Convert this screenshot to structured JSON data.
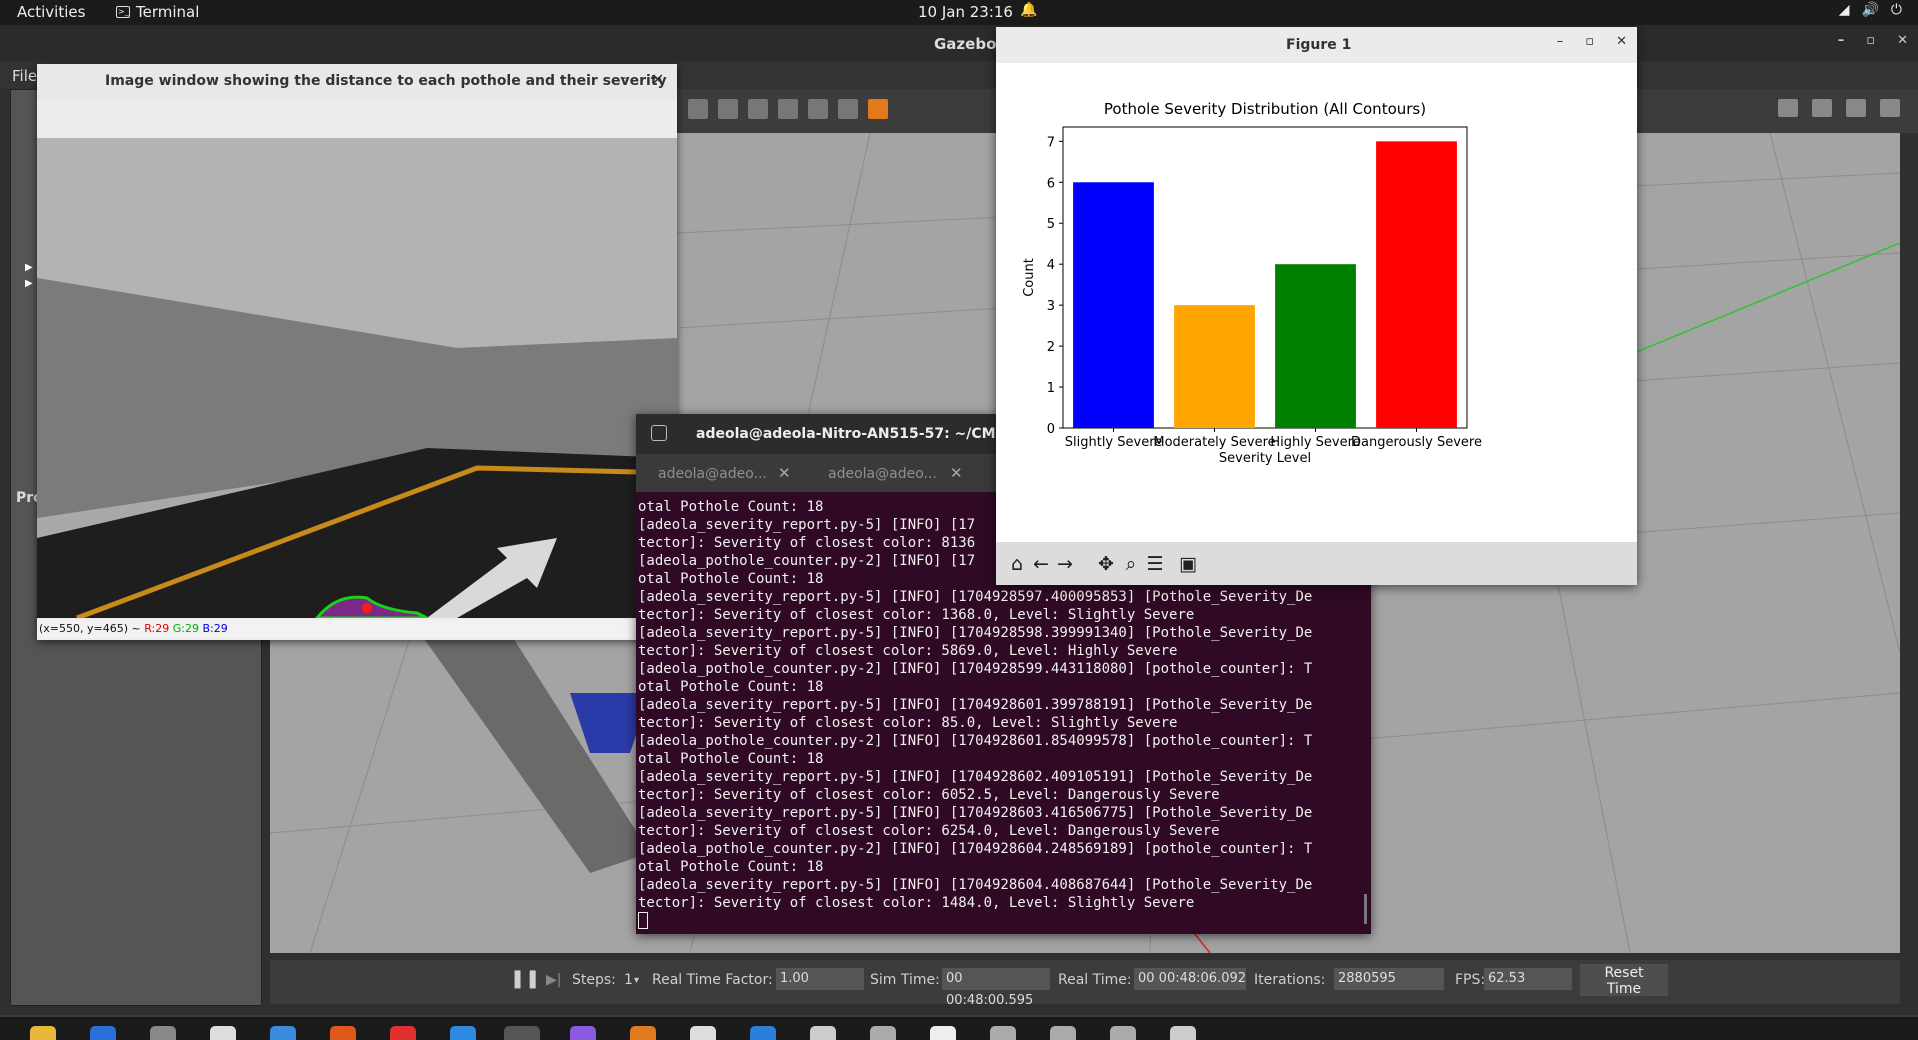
{
  "topbar": {
    "activities": "Activities",
    "app_name": "Terminal",
    "clock": "10 Jan  23:16"
  },
  "gazebo": {
    "title": "Gazebo",
    "menu_file": "File",
    "left_panel_label": "Pro",
    "bottom": {
      "steps_label": "Steps:",
      "steps_value": "1",
      "rtf_label": "Real Time Factor:",
      "rtf_value": "1.00",
      "sim_time_label": "Sim Time:",
      "sim_time_value": "00 00:48:00.595",
      "real_time_label": "Real Time:",
      "real_time_value": "00 00:48:06.092",
      "iterations_label": "Iterations:",
      "iterations_value": "2880595",
      "fps_label": "FPS:",
      "fps_value": "62.53",
      "reset_label": "Reset Time"
    }
  },
  "image_window": {
    "title": "Image window showing the distance to each pothole and their severity",
    "status_pos": "(x=550, y=465) ~",
    "status_r": "R:29",
    "status_g": "G:29",
    "status_b": "B:29"
  },
  "terminal": {
    "title": "adeola@adeola-Nitro-AN515-57: ~/CMP97",
    "tab1": "adeola@adeo...",
    "tab2": "adeola@adeo...",
    "lines": [
      "otal Pothole Count: 18",
      "[adeola_severity_report.py-5] [INFO] [17",
      "tector]: Severity of closest color: 8136",
      "[adeola_pothole_counter.py-2] [INFO] [17",
      "otal Pothole Count: 18",
      "[adeola_severity_report.py-5] [INFO] [1704928597.400095853] [Pothole_Severity_De",
      "tector]: Severity of closest color: 1368.0, Level: Slightly Severe",
      "[adeola_severity_report.py-5] [INFO] [1704928598.399991340] [Pothole_Severity_De",
      "tector]: Severity of closest color: 5869.0, Level: Highly Severe",
      "[adeola_pothole_counter.py-2] [INFO] [1704928599.443118080] [pothole_counter]: T",
      "otal Pothole Count: 18",
      "[adeola_severity_report.py-5] [INFO] [1704928601.399788191] [Pothole_Severity_De",
      "tector]: Severity of closest color: 85.0, Level: Slightly Severe",
      "[adeola_pothole_counter.py-2] [INFO] [1704928601.854099578] [pothole_counter]: T",
      "otal Pothole Count: 18",
      "[adeola_severity_report.py-5] [INFO] [1704928602.409105191] [Pothole_Severity_De",
      "tector]: Severity of closest color: 6052.5, Level: Dangerously Severe",
      "[adeola_severity_report.py-5] [INFO] [1704928603.416506775] [Pothole_Severity_De",
      "tector]: Severity of closest color: 6254.0, Level: Dangerously Severe",
      "[adeola_pothole_counter.py-2] [INFO] [1704928604.248569189] [pothole_counter]: T",
      "otal Pothole Count: 18",
      "[adeola_severity_report.py-5] [INFO] [1704928604.408687644] [Pothole_Severity_De",
      "tector]: Severity of closest color: 1484.0, Level: Slightly Severe"
    ]
  },
  "figure": {
    "window_title": "Figure 1"
  },
  "chart_data": {
    "type": "bar",
    "title": "Pothole Severity Distribution (All Contours)",
    "xlabel": "Severity Level",
    "ylabel": "Count",
    "categories": [
      "Slightly Severe",
      "Moderately Severe",
      "Highly Severe",
      "Dangerously Severe"
    ],
    "values": [
      6,
      3,
      4,
      7
    ],
    "colors": [
      "#0000ff",
      "#ffa500",
      "#008000",
      "#ff0000"
    ],
    "ylim": [
      0,
      7.35
    ],
    "yticks": [
      0,
      1,
      2,
      3,
      4,
      5,
      6,
      7
    ],
    "grid": false
  }
}
